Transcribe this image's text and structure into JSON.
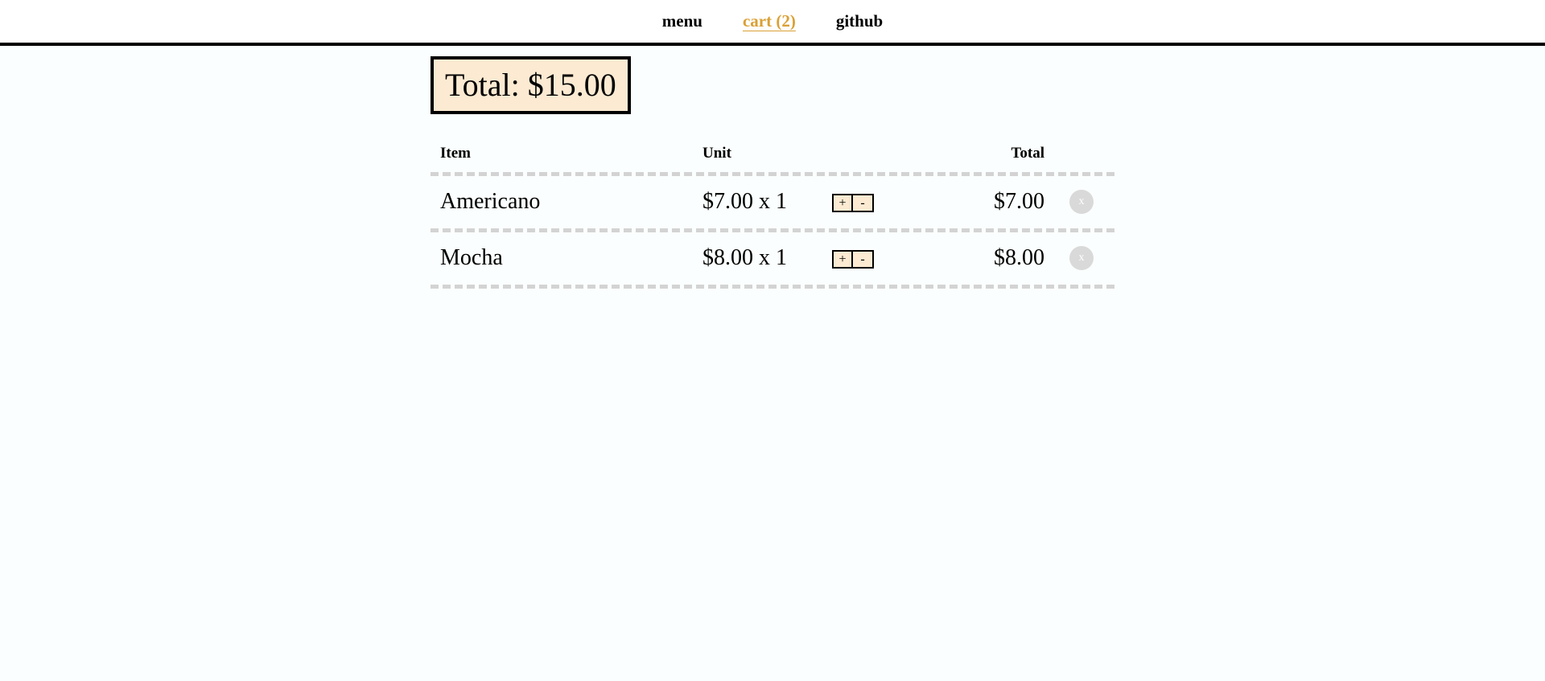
{
  "nav": {
    "menu_label": "menu",
    "cart_label": "cart (2)",
    "github_label": "github"
  },
  "colors": {
    "active_nav": "#daa035",
    "total_box_bg": "#fcead2",
    "divider": "#d3d3d3"
  },
  "cart": {
    "total_label": "Total: $15.00",
    "headers": {
      "item": "Item",
      "unit": "Unit",
      "total": "Total"
    },
    "rows": [
      {
        "item": "Americano",
        "unit": "$7.00 x 1",
        "plus": "+",
        "minus": "-",
        "total": "$7.00",
        "remove": "x"
      },
      {
        "item": "Mocha",
        "unit": "$8.00 x 1",
        "plus": "+",
        "minus": "-",
        "total": "$8.00",
        "remove": "x"
      }
    ]
  }
}
